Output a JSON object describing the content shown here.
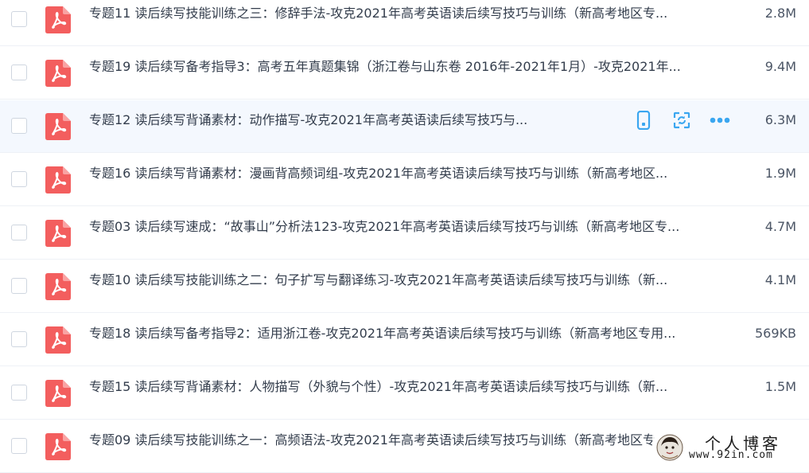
{
  "files": [
    {
      "name": "专题11 读后续写技能训练之三：修辞手法-攻克2021年高考英语读后续写技巧与训练（新高考地区专...",
      "size": "2.8M"
    },
    {
      "name": "专题19 读后续写备考指导3：高考五年真题集锦（浙江卷与山东卷 2016年-2021年1月）-攻克2021年...",
      "size": "9.4M"
    },
    {
      "name": "专题12 读后续写背诵素材：动作描写-攻克2021年高考英语读后续写技巧与...",
      "size": "6.3M",
      "hovered": true
    },
    {
      "name": "专题16 读后续写背诵素材：漫画背高频词组-攻克2021年高考英语读后续写技巧与训练（新高考地区...",
      "size": "1.9M"
    },
    {
      "name": "专题03 读后续写速成：“故事山”分析法123-攻克2021年高考英语读后续写技巧与训练（新高考地区专...",
      "size": "4.7M"
    },
    {
      "name": "专题10 读后续写技能训练之二：句子扩写与翻译练习-攻克2021年高考英语读后续写技巧与训练（新...",
      "size": "4.1M"
    },
    {
      "name": "专题18 读后续写备考指导2：适用浙江卷-攻克2021年高考英语读后续写技巧与训练（新高考地区专用...",
      "size": "569KB"
    },
    {
      "name": "专题15 读后续写背诵素材：人物描写（外貌与个性）-攻克2021年高考英语读后续写技巧与训练（新...",
      "size": "1.5M"
    },
    {
      "name": "专题09 读后续写技能训练之一：高频语法-攻克2021年高考英语读后续写技巧与训练（新高考地区专...",
      "size": ""
    }
  ],
  "row_actions": [
    {
      "icon": "phone-icon",
      "label": "phone"
    },
    {
      "icon": "share-icon",
      "label": "share"
    },
    {
      "icon": "more-icon",
      "label": "more"
    }
  ],
  "file_type_icon": "pdf-icon",
  "colors": {
    "pdf_red": "#f35e5e",
    "action_blue": "#3aa6f0",
    "hover_row": "#f4f8fe"
  },
  "watermark": {
    "title": "个人博客",
    "url": "www.92in.com"
  }
}
